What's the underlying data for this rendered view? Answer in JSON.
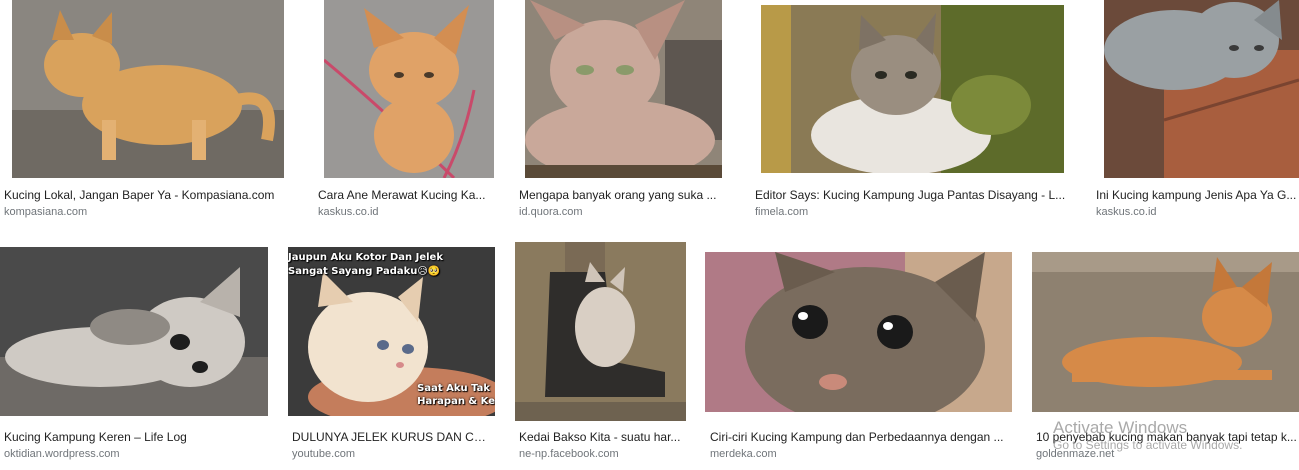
{
  "results": [
    {
      "caption": "Kucing Lokal, Jangan Baper Ya - Kompasiana.com",
      "source": "kompasiana.com",
      "palette": [
        "#8a8680",
        "#d9a25c",
        "#6f6a63"
      ]
    },
    {
      "caption": "Cara Ane Merawat Kucing Ka...",
      "source": "kaskus.co.id",
      "palette": [
        "#9a9896",
        "#e0a267",
        "#c94a6a"
      ]
    },
    {
      "caption": "Mengapa banyak orang yang suka ...",
      "source": "id.quora.com",
      "palette": [
        "#8f8578",
        "#c9a89a",
        "#5d5650"
      ]
    },
    {
      "caption": "Editor Says: Kucing Kampung Juga Pantas Disayang - L...",
      "source": "fimela.com",
      "palette": [
        "#5d6b2a",
        "#e9e5df",
        "#8a7a55"
      ]
    },
    {
      "caption": "Ini Kucing kampung Jenis Apa Ya G...",
      "source": "kaskus.co.id",
      "palette": [
        "#a85e3e",
        "#9aa0a3",
        "#6b4a3a"
      ]
    },
    {
      "caption": "Kucing Kampung Keren – Life Log",
      "source": "oktidian.wordpress.com",
      "palette": [
        "#4a4a4a",
        "#cfcac4",
        "#6e6a66"
      ]
    },
    {
      "caption": "DULUNYA JELEK KURUS DAN CAC...",
      "source": "youtube.com",
      "palette": [
        "#3b3b3b",
        "#f2e3cf",
        "#c47d5c"
      ],
      "overlay_top": [
        "Jaupun Aku Kotor Dan Jelek",
        "Sangat Sayang Padaku😥🥺"
      ],
      "overlay_bottom": [
        "Saat Aku Tak",
        "Harapan & Ke"
      ]
    },
    {
      "caption": "Kedai Bakso Kita - suatu har...",
      "source": "ne-np.facebook.com",
      "palette": [
        "#8a7a5e",
        "#2f2d2b",
        "#d9cfc4"
      ]
    },
    {
      "caption": "Ciri-ciri Kucing Kampung dan Perbedaannya dengan ...",
      "source": "merdeka.com",
      "palette": [
        "#b07a86",
        "#7a6c5e",
        "#c7a88c"
      ]
    },
    {
      "caption": "10 penyebab kucing makan banyak tapi tetap k...",
      "source": "goldenmaze.net",
      "palette": [
        "#a89a88",
        "#d68a48",
        "#8e8170"
      ]
    }
  ],
  "watermark": {
    "title": "Activate Windows",
    "subtitle": "Go to Settings to activate Windows."
  }
}
